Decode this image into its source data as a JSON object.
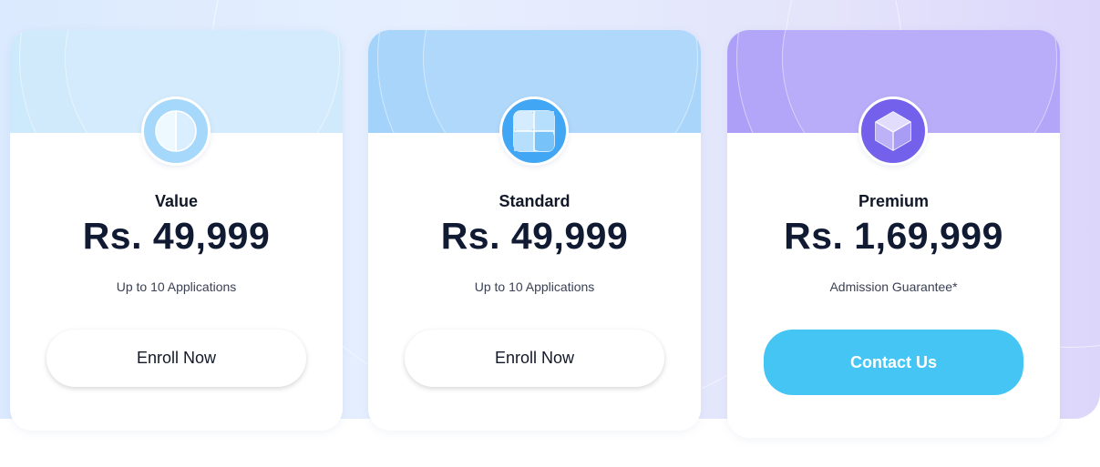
{
  "plans": [
    {
      "name": "Value",
      "price": "Rs. 49,999",
      "subtext": "Up to 10 Applications",
      "cta_label": "Enroll Now",
      "icon": "half-circle-icon",
      "color": "#cde9fc"
    },
    {
      "name": "Standard",
      "price": "Rs. 49,999",
      "subtext": "Up to 10 Applications",
      "cta_label": "Enroll Now",
      "icon": "grid-square-icon",
      "color": "#a3d2fa"
    },
    {
      "name": "Premium",
      "price": "Rs. 1,69,999",
      "subtext": "Admission Guarantee*",
      "cta_label": "Contact Us",
      "icon": "hexagon-cube-icon",
      "color": "#ad9ef8"
    }
  ],
  "colors": {
    "cta_filled": "#44c5f4",
    "text_dark": "#111a33"
  }
}
